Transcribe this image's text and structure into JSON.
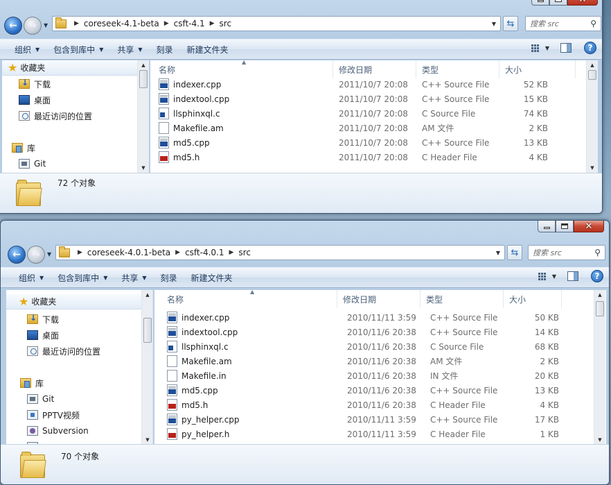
{
  "windows": [
    {
      "address": {
        "crumbs": [
          "coreseek-4.1-beta",
          "csft-4.1",
          "src"
        ]
      },
      "search_placeholder": "搜索 src",
      "toolbar": {
        "organize": "组织",
        "include": "包含到库中",
        "share": "共享",
        "burn": "刻录",
        "newfolder": "新建文件夹"
      },
      "nav": {
        "favorites": "收藏夹",
        "downloads": "下载",
        "desktop": "桌面",
        "recent": "最近访问的位置",
        "libraries": "库",
        "git": "Git"
      },
      "columns": {
        "name": "名称",
        "date": "修改日期",
        "type": "类型",
        "size": "大小"
      },
      "files": [
        {
          "name": "indexer.cpp",
          "date": "2011/10/7 20:08",
          "type": "C++ Source File",
          "size": "52 KB",
          "icon": "cpp"
        },
        {
          "name": "indextool.cpp",
          "date": "2011/10/7 20:08",
          "type": "C++ Source File",
          "size": "15 KB",
          "icon": "cpp"
        },
        {
          "name": "llsphinxql.c",
          "date": "2011/10/7 20:08",
          "type": "C Source File",
          "size": "74 KB",
          "icon": "c"
        },
        {
          "name": "Makefile.am",
          "date": "2011/10/7 20:08",
          "type": "AM 文件",
          "size": "2 KB",
          "icon": "generic"
        },
        {
          "name": "md5.cpp",
          "date": "2011/10/7 20:08",
          "type": "C++ Source File",
          "size": "13 KB",
          "icon": "cpp"
        },
        {
          "name": "md5.h",
          "date": "2011/10/7 20:08",
          "type": "C Header File",
          "size": "4 KB",
          "icon": "h"
        }
      ],
      "status": {
        "count": "72 个对象"
      }
    },
    {
      "address": {
        "crumbs": [
          "coreseek-4.0.1-beta",
          "csft-4.0.1",
          "src"
        ]
      },
      "search_placeholder": "搜索 src",
      "toolbar": {
        "organize": "组织",
        "include": "包含到库中",
        "share": "共享",
        "burn": "刻录",
        "newfolder": "新建文件夹"
      },
      "nav": {
        "favorites": "收藏夹",
        "downloads": "下载",
        "desktop": "桌面",
        "recent": "最近访问的位置",
        "libraries": "库",
        "git": "Git",
        "pptv": "PPTV视频",
        "subversion": "Subversion"
      },
      "columns": {
        "name": "名称",
        "date": "修改日期",
        "type": "类型",
        "size": "大小"
      },
      "files": [
        {
          "name": "indexer.cpp",
          "date": "2010/11/11 3:59",
          "type": "C++ Source File",
          "size": "50 KB",
          "icon": "cpp"
        },
        {
          "name": "indextool.cpp",
          "date": "2010/11/6 20:38",
          "type": "C++ Source File",
          "size": "14 KB",
          "icon": "cpp"
        },
        {
          "name": "llsphinxql.c",
          "date": "2010/11/6 20:38",
          "type": "C Source File",
          "size": "68 KB",
          "icon": "c"
        },
        {
          "name": "Makefile.am",
          "date": "2010/11/6 20:38",
          "type": "AM 文件",
          "size": "2 KB",
          "icon": "generic"
        },
        {
          "name": "Makefile.in",
          "date": "2010/11/6 20:38",
          "type": "IN 文件",
          "size": "20 KB",
          "icon": "generic"
        },
        {
          "name": "md5.cpp",
          "date": "2010/11/6 20:38",
          "type": "C++ Source File",
          "size": "13 KB",
          "icon": "cpp"
        },
        {
          "name": "md5.h",
          "date": "2010/11/6 20:38",
          "type": "C Header File",
          "size": "4 KB",
          "icon": "h"
        },
        {
          "name": "py_helper.cpp",
          "date": "2010/11/11 3:59",
          "type": "C++ Source File",
          "size": "17 KB",
          "icon": "cpp"
        },
        {
          "name": "py_helper.h",
          "date": "2010/11/11 3:59",
          "type": "C Header File",
          "size": "1 KB",
          "icon": "h"
        }
      ],
      "status": {
        "count": "70 个对象"
      }
    }
  ]
}
